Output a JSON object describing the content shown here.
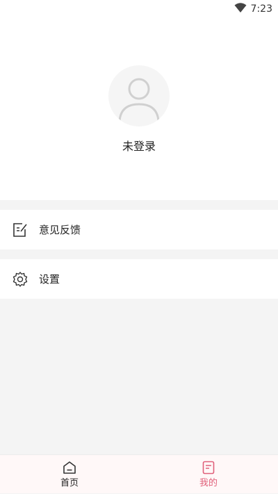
{
  "status_bar": {
    "time": "7:23",
    "wifi_icon": "wifi-icon"
  },
  "profile": {
    "avatar_icon": "default-avatar-icon",
    "login_status": "未登录"
  },
  "menu": [
    {
      "icon": "edit-note-icon",
      "label": "意见反馈"
    },
    {
      "icon": "gear-icon",
      "label": "设置"
    }
  ],
  "tabbar": {
    "tabs": [
      {
        "icon": "home-icon",
        "label": "首页",
        "active": false
      },
      {
        "icon": "document-icon",
        "label": "我的",
        "active": true
      }
    ]
  },
  "colors": {
    "accent": "#e0607a",
    "background": "#f4f4f4"
  }
}
